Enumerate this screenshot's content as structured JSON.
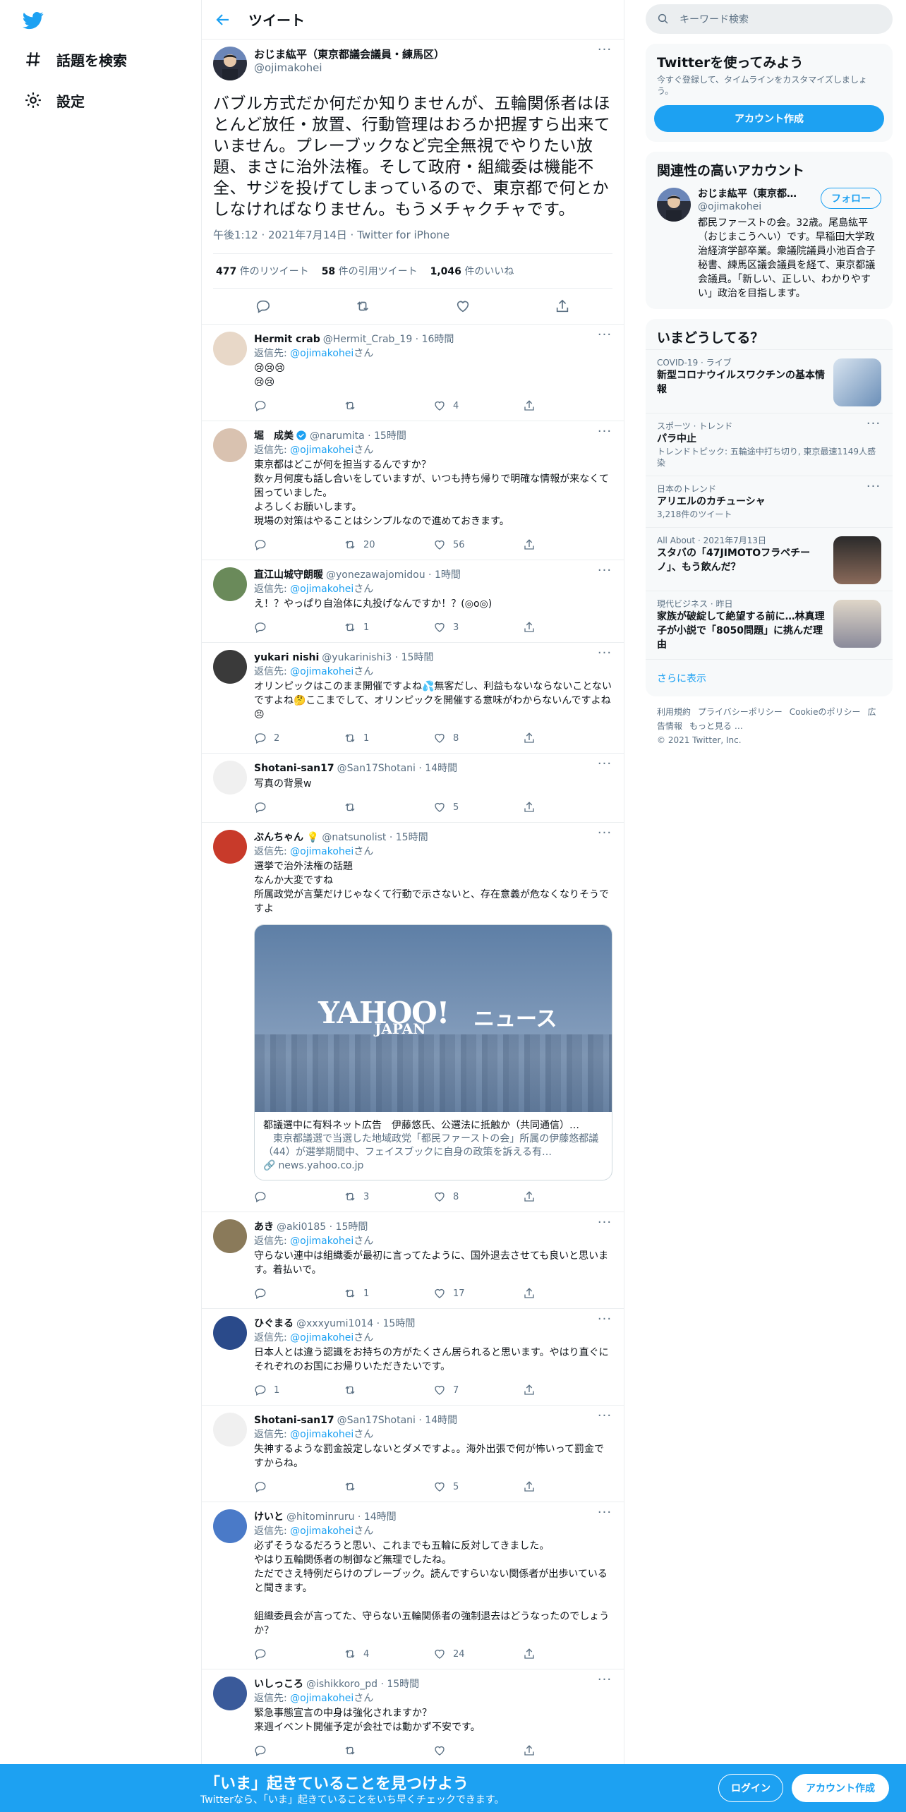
{
  "nav": {
    "explore_label": "話題を検索",
    "settings_label": "設定"
  },
  "header": {
    "title": "ツイート"
  },
  "focal": {
    "name": "おじま紘平（東京都議会議員・練馬区）",
    "handle": "@ojimakohei",
    "text": "バブル方式だか何だか知りませんが、五輪関係者はほとんど放任・放置、行動管理はおろか把握すら出来ていません。プレーブックなど完全無視でやりたい放題、まさに治外法権。そして政府・組織委は機能不全、サジを投げてしまっているので、東京都で何とかしなければなりません。もうメチャクチャです。",
    "meta": "午後1:12 · 2021年7月14日 · Twitter for iPhone",
    "retweets": "477",
    "retweets_label": "件のリツイート",
    "quotes": "58",
    "quotes_label": "件の引用ツイート",
    "likes": "1,046",
    "likes_label": "件のいいね"
  },
  "replies": [
    {
      "name": "Hermit crab",
      "handle": "@Hermit_Crab_19 · 16時間",
      "reply_to": "@ojimakohei",
      "text": "😢😢😢\n😢😢",
      "reply": "",
      "rt": "",
      "like": "4",
      "avatar_color": "#e8d8c8"
    },
    {
      "name": "堀　成美",
      "handle": "@narumita · 15時間",
      "reply_to": "@ojimakohei",
      "text": "東京都はどこが何を担当するんですか？\n数ヶ月何度も話し合いをしていますが、いつも持ち帰りで明確な情報が来なくて困っていました。\nよろしくお願いします。\n現場の対策はやることはシンプルなので進めておきます。",
      "reply": "",
      "rt": "20",
      "like": "56",
      "avatar_color": "#d9c2b0",
      "verified": true
    },
    {
      "name": "直江山城守朗暖",
      "handle": "@yonezawajomidou · 1時間",
      "reply_to": "@ojimakohei",
      "text": "え！？やっぱり自治体に丸投げなんですか！？(◎o◎)",
      "reply": "",
      "rt": "1",
      "like": "3",
      "avatar_color": "#6a8a5a"
    },
    {
      "name": "yukari nishi",
      "handle": "@yukarinishi3 · 15時間",
      "reply_to": "@ojimakohei",
      "text": "オリンピックはこのまま開催ですよね💦無客だし、利益もないならないことないですよね🤔ここまでして、オリンピックを開催する意味がわからないんですよね😣",
      "reply": "2",
      "rt": "1",
      "like": "8",
      "avatar_color": "#3a3a3a"
    },
    {
      "name": "Shotani-san17",
      "handle": "@San17Shotani · 14時間",
      "reply_to": "",
      "text": "写真の背景w",
      "reply": "",
      "rt": "",
      "like": "5",
      "avatar_color": "#f0f0f0"
    },
    {
      "name": "ぶんちゃん 💡",
      "handle": "@natsunolist · 15時間",
      "reply_to": "@ojimakohei",
      "text": "選挙で治外法権の話題\nなんか大変ですね\n所属政党が言葉だけじゃなくて行動で示さないと、存在意義が危なくなりそうですよ",
      "reply": "",
      "rt": "3",
      "like": "8",
      "avatar_color": "#c83a2a",
      "card": true
    },
    {
      "name": "あき",
      "handle": "@aki0185 · 15時間",
      "reply_to": "@ojimakohei",
      "text": "守らない連中は組織委が最初に言ってたように、国外退去させても良いと思います。着払いで。",
      "reply": "",
      "rt": "1",
      "like": "17",
      "avatar_color": "#8a7a5a"
    },
    {
      "name": "ひぐまる",
      "handle": "@xxxyumi1014 · 15時間",
      "reply_to": "@ojimakohei",
      "text": "日本人とは違う認識をお持ちの方がたくさん居られると思います。やはり直ぐにそれぞれのお国にお帰りいただきたいです。",
      "reply": "1",
      "rt": "",
      "like": "7",
      "avatar_color": "#2a4a8a"
    },
    {
      "name": "Shotani-san17",
      "handle": "@San17Shotani · 14時間",
      "reply_to": "@ojimakohei",
      "text": "失神するような罰金設定しないとダメですよ。。海外出張で何が怖いって罰金ですからね。",
      "reply": "",
      "rt": "",
      "like": "5",
      "avatar_color": "#f0f0f0"
    },
    {
      "name": "けいと",
      "handle": "@hitominruru · 14時間",
      "reply_to": "@ojimakohei",
      "text": "必ずそうなるだろうと思い、これまでも五輪に反対してきました。\nやはり五輪関係者の制御など無理でしたね。\nただでさえ特例だらけのプレーブック。読んですらいない関係者が出歩いていると聞きます。\n\n組織委員会が言ってた、守らない五輪関係者の強制退去はどうなったのでしょうか？",
      "reply": "",
      "rt": "4",
      "like": "24",
      "avatar_color": "#4a7ac8"
    },
    {
      "name": "いしっころ",
      "handle": "@ishikkoro_pd · 15時間",
      "reply_to": "@ojimakohei",
      "text": "緊急事態宣言の中身は強化されますか？\n来週イベント開催予定が会社では動かず不安です。",
      "reply": "",
      "rt": "",
      "like": "",
      "avatar_color": "#3a5a9a"
    }
  ],
  "card": {
    "title": "都議選中に有料ネット広告　伊藤悠氏、公選法に抵触か（共同通信）…",
    "desc": "　東京都議選で当選した地域政党「都民ファーストの会」所属の伊藤悠都議（44）が選挙期間中、フェイスブックに自身の政策を訴える有…",
    "url": "news.yahoo.co.jp",
    "logo_text": "YAHOO!",
    "logo_sub": "JAPAN",
    "logo_news": "ニュース"
  },
  "right": {
    "search_placeholder": "キーワード検索",
    "signup_title": "Twitterを使ってみよう",
    "signup_sub": "今すぐ登録して、タイムラインをカスタマイズしましょう。",
    "signup_button": "アカウント作成",
    "related_title": "関連性の高いアカウント",
    "related_name": "おじま紘平（東京都…",
    "related_handle": "@ojimakohei",
    "related_bio": "都民ファーストの会。32歳。尾島紘平（おじまこうへい）です。早稲田大学政治経済学部卒業。衆議院議員小池百合子秘書、練馬区議会議員を経て、東京都議会議員。「新しい、正しい、わかりやすい」政治を目指します。",
    "follow_button": "フォロー",
    "trends_title": "いまどうしてる？",
    "trends": [
      {
        "ctx": "COVID-19 · ライブ",
        "title": "新型コロナウイルスワクチンの基本情報",
        "sub": ""
      },
      {
        "ctx": "スポーツ · トレンド",
        "title": "パラ中止",
        "sub": "トレンドトピック: 五輪途中打ち切り, 東京最速1149人感染"
      },
      {
        "ctx": "日本のトレンド",
        "title": "アリエルのカチューシャ",
        "sub": "3,218件のツイート"
      },
      {
        "ctx": "All About · 2021年7月13日",
        "title": "スタバの「47JIMOTOフラペチーノ」、もう飲んだ？",
        "sub": ""
      },
      {
        "ctx": "現代ビジネス · 昨日",
        "title": "家族が破綻して絶望する前に…林真理子が小説で「8050問題」に挑んだ理由",
        "sub": ""
      }
    ],
    "show_more": "さらに表示",
    "footer_links": [
      "利用規約",
      "プライバシーポリシー",
      "Cookieのポリシー",
      "広告情報",
      "もっと見る …"
    ],
    "copyright": "© 2021 Twitter, Inc."
  },
  "bottom": {
    "title": "「いま」起きていることを見つけよう",
    "sub": "Twitterなら、「いま」起きていることをいち早くチェックできます。",
    "login": "ログイン",
    "register": "アカウント作成"
  },
  "colors": {
    "accent": "#1da1f2",
    "text": "#0f1419",
    "secondary": "#5b7083",
    "border": "#ebeef0"
  }
}
